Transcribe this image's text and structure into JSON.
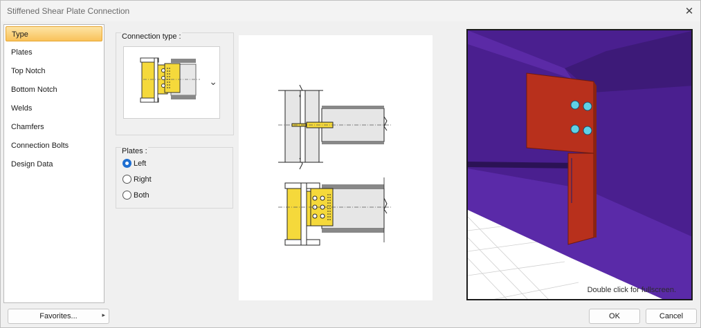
{
  "window": {
    "title": "Stiffened Shear Plate Connection",
    "close_glyph": "✕"
  },
  "sidebar": {
    "items": [
      {
        "label": "Type",
        "active": true
      },
      {
        "label": "Plates"
      },
      {
        "label": "Top Notch"
      },
      {
        "label": "Bottom Notch"
      },
      {
        "label": "Welds"
      },
      {
        "label": "Chamfers"
      },
      {
        "label": "Connection Bolts"
      },
      {
        "label": "Design Data"
      }
    ]
  },
  "connection_type": {
    "label": "Connection type :",
    "dropdown_glyph": "⌄"
  },
  "plates": {
    "label": "Plates :",
    "options": [
      {
        "label": "Left",
        "checked": true
      },
      {
        "label": "Right"
      },
      {
        "label": "Both"
      }
    ]
  },
  "view3d": {
    "hint": "Double click for fullscreen."
  },
  "colors": {
    "plate": "#b8301c",
    "beam": "#4a1f8f",
    "weld": "#f5d93b",
    "accent": "#1f6fd1"
  },
  "footer": {
    "favorites_label": "Favorites...",
    "favorites_arrow": "▸",
    "ok_label": "OK",
    "cancel_label": "Cancel"
  }
}
